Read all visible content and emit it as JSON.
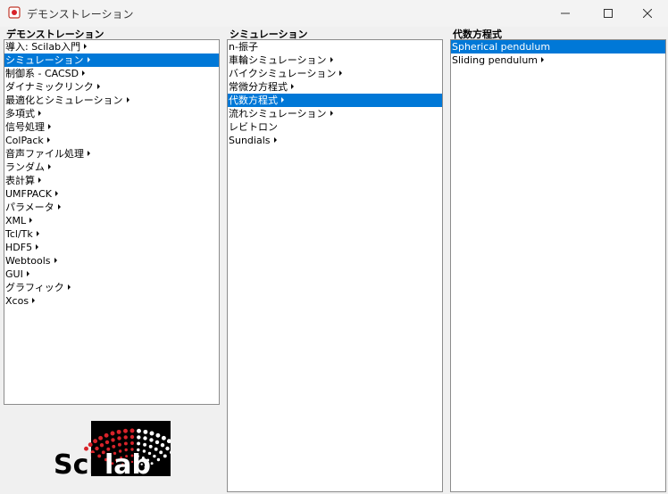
{
  "window": {
    "title": "デモンストレーション"
  },
  "columns": [
    {
      "header": "デモンストレーション",
      "items": [
        {
          "label": "導入: Scilab入門",
          "submenu": true
        },
        {
          "label": "シミュレーション",
          "submenu": true,
          "selected": true
        },
        {
          "label": "制御系 - CACSD",
          "submenu": true
        },
        {
          "label": "ダイナミックリンク",
          "submenu": true
        },
        {
          "label": "最適化とシミュレーション",
          "submenu": true
        },
        {
          "label": "多項式",
          "submenu": true
        },
        {
          "label": "信号処理",
          "submenu": true
        },
        {
          "label": "ColPack",
          "submenu": true
        },
        {
          "label": "音声ファイル処理",
          "submenu": true
        },
        {
          "label": "ランダム",
          "submenu": true
        },
        {
          "label": "表計算",
          "submenu": true
        },
        {
          "label": "UMFPACK",
          "submenu": true
        },
        {
          "label": "パラメータ",
          "submenu": true
        },
        {
          "label": "XML",
          "submenu": true
        },
        {
          "label": "Tcl/Tk",
          "submenu": true
        },
        {
          "label": "HDF5",
          "submenu": true
        },
        {
          "label": "Webtools",
          "submenu": true
        },
        {
          "label": "GUI",
          "submenu": true
        },
        {
          "label": "グラフィック",
          "submenu": true
        },
        {
          "label": "Xcos",
          "submenu": true
        }
      ]
    },
    {
      "header": "シミュレーション",
      "items": [
        {
          "label": "n-振子",
          "submenu": false
        },
        {
          "label": "車輪シミュレーション",
          "submenu": true
        },
        {
          "label": "バイクシミュレーション",
          "submenu": true
        },
        {
          "label": "常微分方程式",
          "submenu": true
        },
        {
          "label": "代数方程式",
          "submenu": true,
          "selected": true
        },
        {
          "label": "流れシミュレーション",
          "submenu": true
        },
        {
          "label": "レビトロン",
          "submenu": false
        },
        {
          "label": "Sundials",
          "submenu": true
        }
      ]
    },
    {
      "header": "代数方程式",
      "items": [
        {
          "label": "Spherical pendulum",
          "submenu": false,
          "selected": true
        },
        {
          "label": "Sliding pendulum",
          "submenu": true
        }
      ]
    }
  ],
  "logo": {
    "text_sci": "Sci",
    "text_lab": "lab"
  },
  "colors": {
    "selection": "#0078d7",
    "logo_red": "#d8232a"
  }
}
